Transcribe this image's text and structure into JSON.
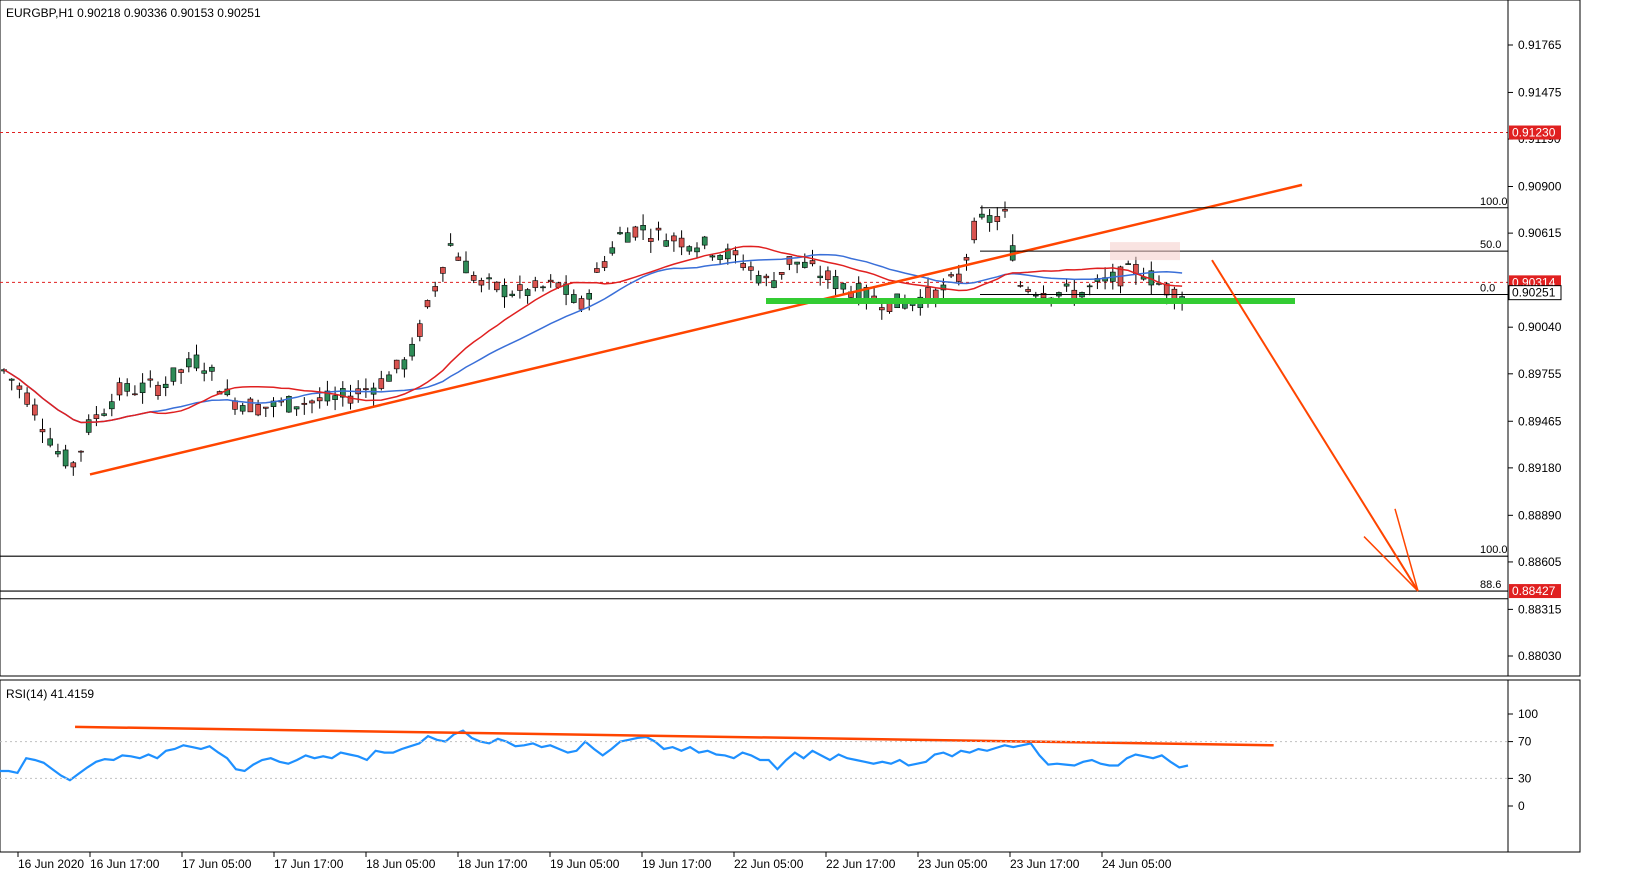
{
  "header": {
    "title": "EURGBP,H1  0.90218 0.90336 0.90153 0.90251"
  },
  "indicator": {
    "title": "RSI(14) 41.4159",
    "ticks": [
      "100",
      "70",
      "30",
      "0"
    ]
  },
  "colors": {
    "bull_candle": "#2e8b57",
    "bear_candle": "#d9534f",
    "ma_fast": "#e02020",
    "ma_slow": "#3a6fd8",
    "trendline": "#ff4500",
    "support": "#33cc33",
    "fib": "#000000",
    "price_label_bg": "#e02020",
    "rsi_line": "#1e90ff"
  },
  "chart_data": {
    "type": "candlestick",
    "symbol": "EURGBP",
    "timeframe": "H1",
    "ohlc_last": {
      "open": 0.90218,
      "high": 0.90336,
      "low": 0.90153,
      "close": 0.90251
    },
    "ylim": [
      0.879,
      0.921
    ],
    "y_ticks": [
      "0.91765",
      "0.91475",
      "0.91190",
      "0.90900",
      "0.90615",
      "0.90040",
      "0.89755",
      "0.89465",
      "0.89180",
      "0.88890",
      "0.88605",
      "0.88315",
      "0.88030"
    ],
    "x_ticks": [
      "16 Jun 2020",
      "16 Jun 17:00",
      "17 Jun 05:00",
      "17 Jun 17:00",
      "18 Jun 05:00",
      "18 Jun 17:00",
      "19 Jun 05:00",
      "19 Jun 17:00",
      "22 Jun 05:00",
      "22 Jun 17:00",
      "23 Jun 05:00",
      "23 Jun 17:00",
      "24 Jun 05:00"
    ],
    "price_labels": [
      {
        "value": 0.9123,
        "text": "0.91230"
      },
      {
        "value": 0.90314,
        "text": "0.90314"
      },
      {
        "value": 0.88427,
        "text": "0.88427"
      }
    ],
    "current_price": {
      "value": 0.90251,
      "text": "0.90251"
    },
    "fib_upper": [
      {
        "level": "100.0",
        "price": 0.9077
      },
      {
        "level": "50.0",
        "price": 0.90505
      },
      {
        "level": "0.0",
        "price": 0.9024
      }
    ],
    "fib_lower": [
      {
        "level": "100.0",
        "price": 0.8864
      },
      {
        "level": "88.6",
        "price": 0.88427
      }
    ],
    "support_level": 0.902,
    "rsi": {
      "period": 14,
      "last": 41.4159,
      "ylim": [
        0,
        100
      ],
      "values": [
        38,
        38,
        36,
        52,
        50,
        47,
        40,
        33,
        28,
        35,
        42,
        48,
        51,
        50,
        55,
        54,
        52,
        56,
        52,
        60,
        62,
        66,
        64,
        62,
        65,
        58,
        52,
        40,
        38,
        45,
        50,
        52,
        48,
        46,
        50,
        55,
        52,
        54,
        52,
        58,
        56,
        54,
        50,
        60,
        58,
        58,
        62,
        65,
        68,
        76,
        72,
        70,
        78,
        82,
        74,
        70,
        68,
        73,
        70,
        65,
        66,
        68,
        64,
        66,
        62,
        58,
        60,
        70,
        62,
        55,
        62,
        70,
        72,
        74,
        75,
        70,
        62,
        64,
        60,
        64,
        58,
        60,
        56,
        55,
        52,
        58,
        55,
        50,
        50,
        40,
        50,
        58,
        52,
        60,
        55,
        50,
        56,
        52,
        50,
        48,
        46,
        48,
        46,
        50,
        44,
        46,
        48,
        56,
        58,
        54,
        60,
        58,
        62,
        60,
        63,
        66,
        64,
        66,
        68,
        55,
        45,
        46,
        45,
        44,
        48,
        50,
        46,
        44,
        44,
        52,
        56,
        54,
        52,
        55,
        48,
        42,
        44
      ],
      "trendline": [
        {
          "x": 0.09,
          "y": 86
        },
        {
          "x": 0.82,
          "y": 66
        }
      ]
    },
    "candles_summary": "Hourly candles from 16 Jun 2020 to 24 Jun 2020, rising from ~0.8920 to a high near 0.9077 then pulling back to 0.9025."
  }
}
